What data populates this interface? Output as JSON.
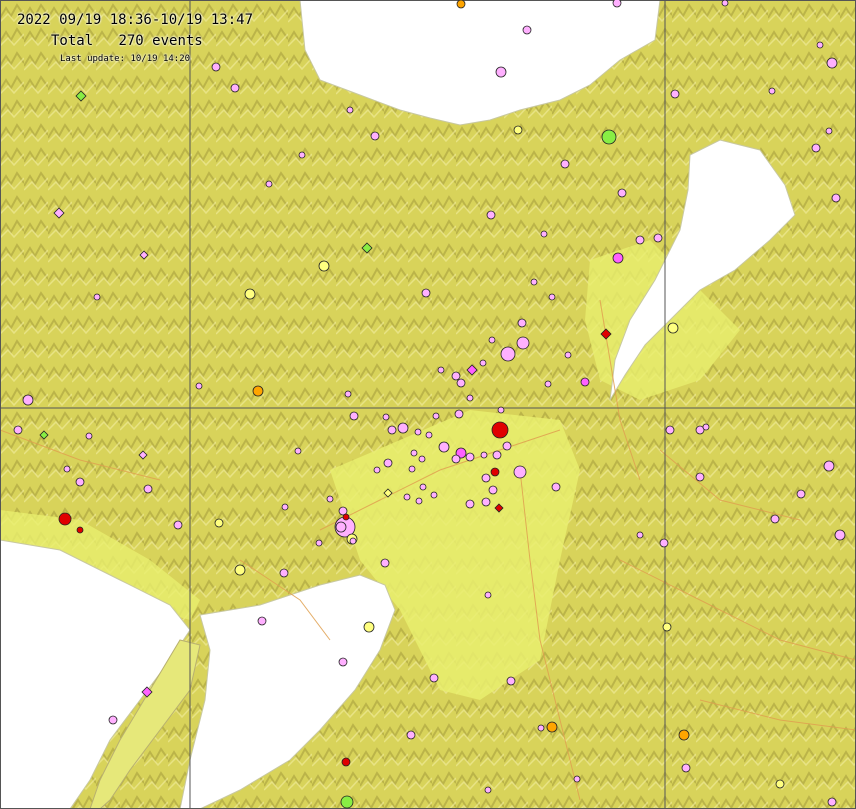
{
  "header": {
    "period": "2022 09/19 18:36-10/19 13:47",
    "total_label": "Total",
    "total_count": "270 events",
    "last_update": "Last update: 10/19 14:20"
  },
  "colors": {
    "land": "#d9d65a",
    "lowland": "#e9ef6e",
    "water": "#ffffff",
    "grid": "#555555",
    "fault": "#e0a050",
    "depth_shallow_red": "#e00000",
    "depth_orange": "#ffa500",
    "depth_yellow": "#ffff80",
    "depth_pink": "#ffb0ff",
    "depth_green": "#88ee44",
    "depth_magenta": "#ff60ff"
  },
  "icons": [
    "earthquake-marker-circle",
    "earthquake-marker-diamond",
    "earthquake-marker-square"
  ]
}
